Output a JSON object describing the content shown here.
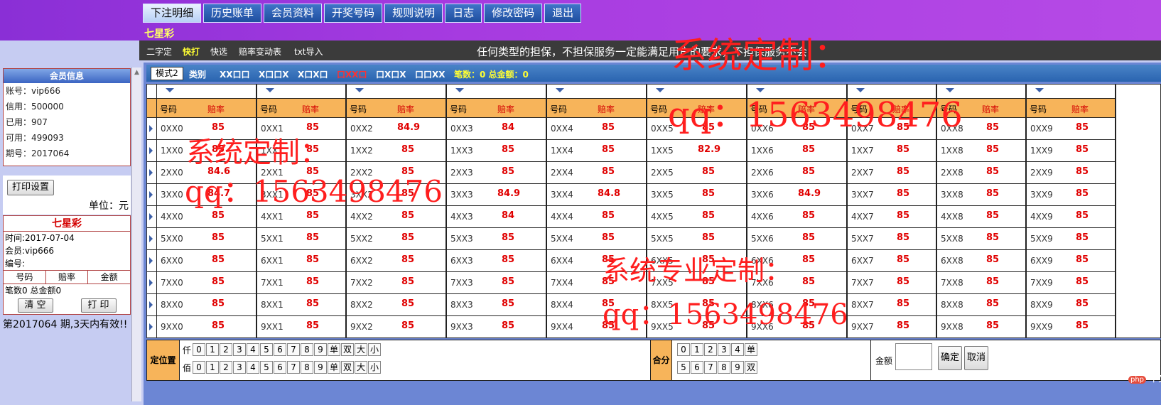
{
  "tabs": [
    "下注明细",
    "历史账单",
    "会员资料",
    "开奖号码",
    "规则说明",
    "日志",
    "修改密码",
    "退出"
  ],
  "game_name": "七星彩",
  "subnav": {
    "items": [
      "二字定",
      "快打",
      "快选",
      "赔率变动表",
      "txt导入"
    ],
    "notice": "任何类型的担保，不担保服务一定能满足用户的要求，不担保服务不会"
  },
  "member_info": {
    "title": "会员信息",
    "rows": [
      "账号：vip666",
      "信用：500000",
      "已用：907",
      "可用：499093",
      "期号：2017064"
    ]
  },
  "print_setting": "打印设置",
  "unit": "单位：元",
  "slip": {
    "title": "七星彩",
    "time": "时间:2017-07-04",
    "member": "会员:vip666",
    "serial": "编号:",
    "cols": [
      "号码",
      "赔率",
      "金额"
    ],
    "summary": "笔数0 总金额0",
    "clear": "清 空",
    "print": "打 印"
  },
  "valid_note": "第2017064 期,3天内有效!!",
  "modebar": {
    "mode2": "模式2",
    "type": "类别",
    "items": [
      "XX口口",
      "X口口X",
      "X口X口",
      "口XX口",
      "口X口X",
      "口口XX"
    ],
    "summary": "笔数：0 总金额：0"
  },
  "grid": {
    "head_num": "号码",
    "head_odds": "赔率",
    "rows": [
      [
        "0XX0",
        "0XX1",
        "0XX2",
        "0XX3",
        "0XX4",
        "0XX5",
        "0XX6",
        "0XX7",
        "0XX8",
        "0XX9"
      ],
      [
        "1XX0",
        "1XX1",
        "1XX2",
        "1XX3",
        "1XX4",
        "1XX5",
        "1XX6",
        "1XX7",
        "1XX8",
        "1XX9"
      ],
      [
        "2XX0",
        "2XX1",
        "2XX2",
        "2XX3",
        "2XX4",
        "2XX5",
        "2XX6",
        "2XX7",
        "2XX8",
        "2XX9"
      ],
      [
        "3XX0",
        "3XX1",
        "3XX2",
        "3XX3",
        "3XX4",
        "3XX5",
        "3XX6",
        "3XX7",
        "3XX8",
        "3XX9"
      ],
      [
        "4XX0",
        "4XX1",
        "4XX2",
        "4XX3",
        "4XX4",
        "4XX5",
        "4XX6",
        "4XX7",
        "4XX8",
        "4XX9"
      ],
      [
        "5XX0",
        "5XX1",
        "5XX2",
        "5XX3",
        "5XX4",
        "5XX5",
        "5XX6",
        "5XX7",
        "5XX8",
        "5XX9"
      ],
      [
        "6XX0",
        "6XX1",
        "6XX2",
        "6XX3",
        "6XX4",
        "6XX5",
        "6XX6",
        "6XX7",
        "6XX8",
        "6XX9"
      ],
      [
        "7XX0",
        "7XX1",
        "7XX2",
        "7XX3",
        "7XX4",
        "7XX5",
        "7XX6",
        "7XX7",
        "7XX8",
        "7XX9"
      ],
      [
        "8XX0",
        "8XX1",
        "8XX2",
        "8XX3",
        "8XX4",
        "8XX5",
        "8XX6",
        "8XX7",
        "8XX8",
        "8XX9"
      ],
      [
        "9XX0",
        "9XX1",
        "9XX2",
        "9XX3",
        "9XX4",
        "9XX5",
        "9XX6",
        "9XX7",
        "9XX8",
        "9XX9"
      ]
    ],
    "odds": [
      [
        "85",
        "85",
        "84.9",
        "84",
        "85",
        "85",
        "85",
        "85",
        "85",
        "85"
      ],
      [
        "85",
        "85",
        "85",
        "85",
        "85",
        "82.9",
        "85",
        "85",
        "85",
        "85"
      ],
      [
        "84.6",
        "85",
        "85",
        "85",
        "85",
        "85",
        "85",
        "85",
        "85",
        "85"
      ],
      [
        "84.7",
        "85",
        "85",
        "84.9",
        "84.8",
        "85",
        "84.9",
        "85",
        "85",
        "85"
      ],
      [
        "85",
        "85",
        "85",
        "84",
        "85",
        "85",
        "85",
        "85",
        "85",
        "85"
      ],
      [
        "85",
        "85",
        "85",
        "85",
        "85",
        "85",
        "85",
        "85",
        "85",
        "85"
      ],
      [
        "85",
        "85",
        "85",
        "85",
        "85",
        "85",
        "85",
        "85",
        "85",
        "85"
      ],
      [
        "85",
        "85",
        "85",
        "85",
        "85",
        "85",
        "85",
        "85",
        "85",
        "85"
      ],
      [
        "85",
        "85",
        "85",
        "85",
        "85",
        "85",
        "85",
        "85",
        "85",
        "85"
      ],
      [
        "85",
        "85",
        "85",
        "85",
        "85",
        "85",
        "85",
        "85",
        "85",
        "85"
      ]
    ]
  },
  "bottom": {
    "fix_label": "定位置",
    "row1_label": "仟",
    "row2_label": "佰",
    "digits": [
      "0",
      "1",
      "2",
      "3",
      "4",
      "5",
      "6",
      "7",
      "8",
      "9",
      "单",
      "双",
      "大",
      "小"
    ],
    "sum_label": "合分",
    "sum_row1": [
      "0",
      "1",
      "2",
      "3",
      "4",
      "单"
    ],
    "sum_row2": [
      "5",
      "6",
      "7",
      "8",
      "9",
      "双"
    ],
    "amount_label": "金额",
    "ok": "确定",
    "cancel": "取消"
  },
  "logo": "中文网",
  "logo_badge": "php",
  "watermarks": [
    "系统定制：",
    "qq：1563498476",
    "系统定制：",
    "qq：1563498476",
    "系统专业定制：",
    "qq：1563498476"
  ]
}
